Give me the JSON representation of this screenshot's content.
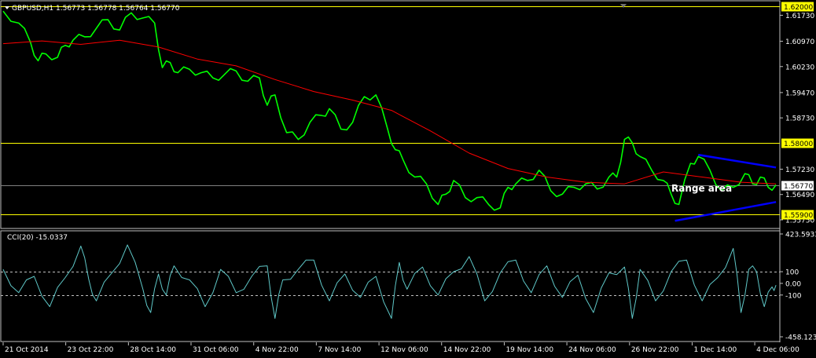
{
  "chart_data": {
    "type": "line",
    "header": "GBPUSD,H1  1.56773 1.56778 1.56764 1.56770",
    "indicator_label": "CCI(20) -15.0337",
    "annotation": "Range area",
    "price_axis": {
      "ylim": [
        1.5552,
        1.6213
      ],
      "ticks": [
        {
          "label": "1.61730",
          "value": 1.6173
        },
        {
          "label": "1.60970",
          "value": 1.6097
        },
        {
          "label": "1.60230",
          "value": 1.6023
        },
        {
          "label": "1.59470",
          "value": 1.5947
        },
        {
          "label": "1.58730",
          "value": 1.5873
        },
        {
          "label": "1.57230",
          "value": 1.5723
        },
        {
          "label": "1.56490",
          "value": 1.5649
        },
        {
          "label": "1.55750",
          "value": 1.5575
        }
      ]
    },
    "horizontal_levels": [
      {
        "label": "1.62000",
        "value": 1.62,
        "color": "#ffff00",
        "box_fill": "#ffff00",
        "box_text": "#000000"
      },
      {
        "label": "1.58000",
        "value": 1.58,
        "color": "#ffff00",
        "box_fill": "#ffff00",
        "box_text": "#000000"
      },
      {
        "label": "1.56770",
        "value": 1.5677,
        "color": "#808080",
        "box_fill": "#ffffff",
        "box_text": "#000000"
      },
      {
        "label": "1.55900",
        "value": 1.559,
        "color": "#ffff00",
        "box_fill": "#ffff00",
        "box_text": "#000000"
      }
    ],
    "cci_axis": {
      "ylim": [
        -458.1239,
        423.5933
      ],
      "ticks": [
        {
          "label": "423.5933",
          "value": 423.5933
        },
        {
          "label": "100",
          "value": 100
        },
        {
          "label": "0.00",
          "value": 0
        },
        {
          "label": "-100",
          "value": -100
        },
        {
          "label": "-458.1239",
          "value": -458.1239
        }
      ],
      "dashed_levels": [
        100,
        -100
      ]
    },
    "x_ticks": [
      "21 Oct 2014",
      "23 Oct 22:00",
      "28 Oct 14:00",
      "31 Oct 06:00",
      "4 Nov 22:00",
      "7 Nov 14:00",
      "12 Nov 06:00",
      "14 Nov 22:00",
      "19 Nov 14:00",
      "24 Nov 06:00",
      "26 Nov 22:00",
      "1 Dec 14:00",
      "4 Dec 06:00"
    ],
    "x_range": [
      0,
      100
    ],
    "x_tick_positions": [
      0,
      8.06,
      16.13,
      24.19,
      32.26,
      40.32,
      48.39,
      56.45,
      64.52,
      72.58,
      80.65,
      88.71,
      96.77
    ],
    "series": [
      {
        "role": "price",
        "color": "#00ff00",
        "x": [
          0,
          2,
          3.5,
          4.5,
          5.5,
          7,
          8,
          9,
          10.5,
          12,
          13.5,
          15,
          16.5,
          18,
          19.5,
          20.5,
          21.5,
          22.5,
          24,
          25.5,
          27,
          28.5,
          30,
          31.5,
          33,
          34,
          35,
          36.5,
          38,
          39.5,
          41,
          42,
          43.5,
          45,
          46.5,
          48,
          49.5,
          50.5,
          51.5,
          53,
          54.5,
          56,
          57,
          58,
          59.5,
          61,
          62.5,
          64,
          65,
          66,
          67.5,
          69,
          70.5,
          72,
          73.5,
          75,
          76.5,
          78,
          79,
          80,
          81,
          82,
          83.5,
          85,
          86,
          87,
          88.5,
          89.5,
          91,
          92.5,
          94,
          95.5,
          96.5,
          97.5,
          98.5,
          99.5
        ],
        "y": [
          1.6185,
          1.615,
          1.6095,
          1.604,
          1.606,
          1.605,
          1.6085,
          1.61,
          1.611,
          1.6135,
          1.616,
          1.613,
          1.618,
          1.6165,
          1.615,
          1.602,
          1.6035,
          1.6005,
          1.6015,
          1.6005,
          1.599,
          1.6,
          1.601,
          1.598,
          1.599,
          1.591,
          1.594,
          1.583,
          1.581,
          1.586,
          1.588,
          1.59,
          1.584,
          1.586,
          1.5935,
          1.594,
          1.584,
          1.578,
          1.575,
          1.57,
          1.568,
          1.562,
          1.565,
          1.569,
          1.564,
          1.564,
          1.562,
          1.561,
          1.567,
          1.568,
          1.569,
          1.572,
          1.566,
          1.565,
          1.567,
          1.568,
          1.5665,
          1.57,
          1.57,
          1.581,
          1.58,
          1.576,
          1.572,
          1.569,
          1.565,
          1.562,
          1.574,
          1.576,
          1.572,
          1.566,
          1.567,
          1.571,
          1.568,
          1.57,
          1.567,
          1.5677
        ]
      },
      {
        "role": "moving-average",
        "color": "#ff0000",
        "x": [
          0,
          5,
          10,
          15,
          20,
          25,
          30,
          35,
          40,
          45,
          50,
          55,
          60,
          65,
          70,
          75,
          80,
          85,
          90,
          95,
          99.5
        ],
        "y": [
          1.609,
          1.6098,
          1.6088,
          1.61,
          1.608,
          1.6045,
          1.6025,
          1.5985,
          1.595,
          1.5925,
          1.5895,
          1.5835,
          1.577,
          1.5725,
          1.57,
          1.5685,
          1.568,
          1.5715,
          1.57,
          1.5685,
          1.568
        ]
      },
      {
        "role": "cci",
        "color": "#5fc8c8",
        "x": [
          0,
          2,
          4,
          6,
          8,
          10,
          11,
          12,
          14,
          16,
          18,
          19,
          20,
          21,
          22,
          24,
          26,
          28,
          30,
          32,
          34,
          35,
          36,
          38,
          40,
          42,
          44,
          46,
          48,
          50,
          51,
          52,
          54,
          56,
          58,
          60,
          62,
          64,
          66,
          68,
          70,
          72,
          74,
          76,
          78,
          80,
          81,
          82,
          84,
          86,
          88,
          90,
          92,
          94,
          95,
          96,
          97,
          98,
          99,
          99.5
        ],
        "y": [
          120,
          -80,
          60,
          -200,
          50,
          320,
          40,
          -150,
          90,
          330,
          -50,
          -250,
          80,
          -100,
          150,
          30,
          -200,
          120,
          -80,
          60,
          150,
          -300,
          30,
          120,
          200,
          -150,
          80,
          -120,
          60,
          -300,
          180,
          -50,
          140,
          -100,
          100,
          230,
          -150,
          90,
          200,
          -80,
          150,
          -120,
          70,
          -250,
          90,
          140,
          -300,
          120,
          -150,
          100,
          200,
          -150,
          50,
          300,
          -250,
          120,
          100,
          -200,
          -30,
          -15
        ]
      }
    ],
    "channel_lines": [
      {
        "color": "#0000ff",
        "x1": 89.5,
        "y1": 1.5765,
        "x2": 99.5,
        "y2": 1.5728
      },
      {
        "color": "#0000ff",
        "x1": 86.5,
        "y1": 1.5572,
        "x2": 99.5,
        "y2": 1.5627
      }
    ]
  }
}
